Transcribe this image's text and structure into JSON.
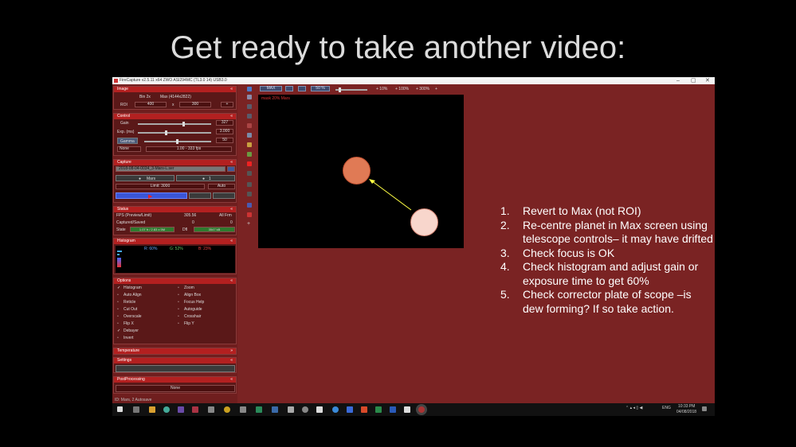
{
  "slide": {
    "title": "Get ready to take another video:"
  },
  "app": {
    "title": "FireCapture v2.5.11  x64    ZWO ASI294MC (TL3.0 14) USB3.0",
    "window_controls": {
      "minimize": "–",
      "maximize": "▢",
      "close": "✕"
    }
  },
  "panels": {
    "image": {
      "title": "Image",
      "bin_label": "Bin 2x",
      "max_label": "Max (4144x2822)",
      "roi_label": "ROI",
      "roi_w": "400",
      "roi_x": "x",
      "roi_h": "300"
    },
    "control": {
      "title": "Control",
      "gain_label": "Gain",
      "gain_value": "327",
      "exp_label": "Exp. (ms)",
      "exp_value": "3.000",
      "gamma_label": "Gamma",
      "gamma_value": "50",
      "mode": "None",
      "fps_range": "1.00 - 333 fps"
    },
    "capture": {
      "title": "Capture",
      "filename": "2018-08-04-0034_3-Mars-L.ser",
      "filter_label": "Mars",
      "count": "1",
      "limit": "Limit: 3000",
      "auto": "Auto",
      "record_label": "▶"
    },
    "status": {
      "title": "Status",
      "fps_label": "FPS (Preview/Limit)",
      "fps_value": "305.56",
      "fps_extra": "All Frm",
      "captured_label": "Captured/Saved",
      "captured_value": "0",
      "captured_extra": "0",
      "state_label": "State",
      "state_value": "1.07 fr / 2.83 x 5M",
      "dx_label": "Dfl",
      "dx_value": "3547 kB"
    },
    "histogram": {
      "title": "Histogram",
      "r": "R: 60%",
      "g": "G: 52%",
      "b": "B: 23%"
    },
    "options": {
      "title": "Options",
      "items_left": [
        "Histogram",
        "Auto Align",
        "Reticle",
        "Cut Out",
        "Overscale",
        "Flip X",
        "Debayer",
        "Invert"
      ],
      "items_right": [
        "Zoom",
        "Align Box",
        "Focus Help",
        "Autoguide",
        "Crosshair",
        "Flip Y",
        "",
        ""
      ],
      "checked_left": [
        true,
        false,
        false,
        false,
        false,
        false,
        true,
        false
      ]
    },
    "temperature": {
      "title": "Temperature"
    },
    "settings": {
      "title": "Settings"
    },
    "postprocessing": {
      "title": "PostProcessing",
      "value": "None"
    },
    "footer": "ID: Mars, 2 Autosave"
  },
  "toolbar": {
    "max_label": "MAX",
    "zoom_label": "50 %",
    "p1": "+ 10%",
    "p2": "+ 100%",
    "p3": "+ 300%",
    "plus": "+"
  },
  "preview": {
    "hud": "mask 20%     Mars"
  },
  "instructions": [
    {
      "num": "1.",
      "text": "Revert to Max (not ROI)"
    },
    {
      "num": "2.",
      "text": "Re-centre planet in Max screen using telescope controls– it may have drifted"
    },
    {
      "num": "3.",
      "text": "Check focus is OK"
    },
    {
      "num": "4.",
      "text": "Check histogram and adjust gain or exposure time to get 60%"
    },
    {
      "num": "5.",
      "text": "Check corrector plate of scope –is dew forming? If so take action."
    }
  ],
  "taskbar": {
    "tray_text": "ENG",
    "time": "10:33 PM",
    "date": "04/08/2018"
  },
  "colors": {
    "app_bg": "#7a2323",
    "panel_header": "#b32020",
    "planet_target": "#e07a55",
    "planet_current": "#f8d6cc",
    "arrow": "#ffff44"
  }
}
